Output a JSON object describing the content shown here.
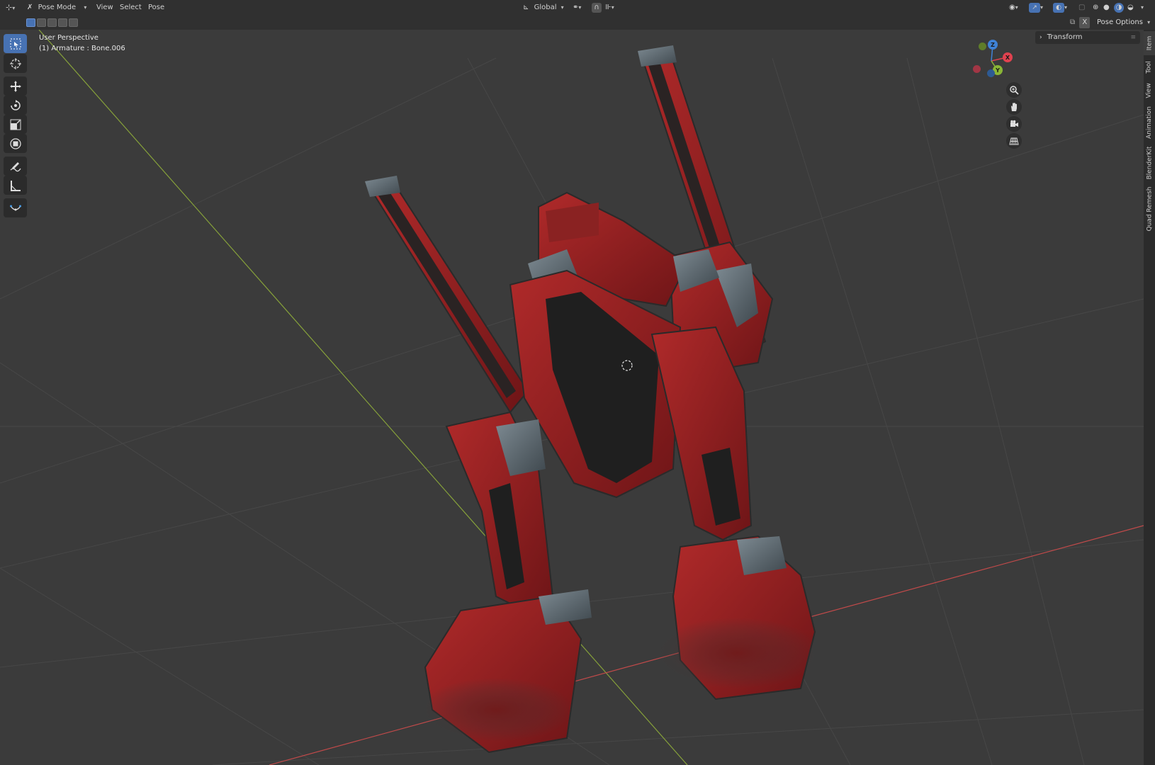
{
  "header": {
    "mode_label": "Pose Mode",
    "menus": [
      "View",
      "Select",
      "Pose"
    ],
    "transform_orientation": "Global",
    "pose_options_label": "Pose Options",
    "x_mirror_label": "X"
  },
  "viewport": {
    "perspective_label": "User Perspective",
    "object_info": "(1) Armature : Bone.006"
  },
  "gizmo": {
    "axes": {
      "x": "X",
      "y": "Y",
      "z": "Z"
    },
    "colors": {
      "x": "#e0424f",
      "y": "#8ab636",
      "z": "#3f82d6",
      "neg_x": "#a23645"
    }
  },
  "npanel": {
    "section_label": "Transform",
    "tabs": [
      "Item",
      "Tool",
      "View",
      "Animation",
      "BlenderKit",
      "Quad Remesh"
    ],
    "active_tab": "Item"
  },
  "toolbar": {
    "tools": [
      "select-box",
      "cursor",
      "move",
      "rotate",
      "scale",
      "transform",
      "annotate",
      "measure",
      "bone-pose-tool"
    ],
    "active_tool": "select-box"
  },
  "colors": {
    "accent": "#4772b3",
    "header_bg": "#303030",
    "viewport_bg": "#3b3b3b",
    "x_axis_line": "#c24a4a",
    "y_axis_line": "#86a13a",
    "mech_red": "#9c1f22",
    "mech_metal": "#5d6870"
  }
}
